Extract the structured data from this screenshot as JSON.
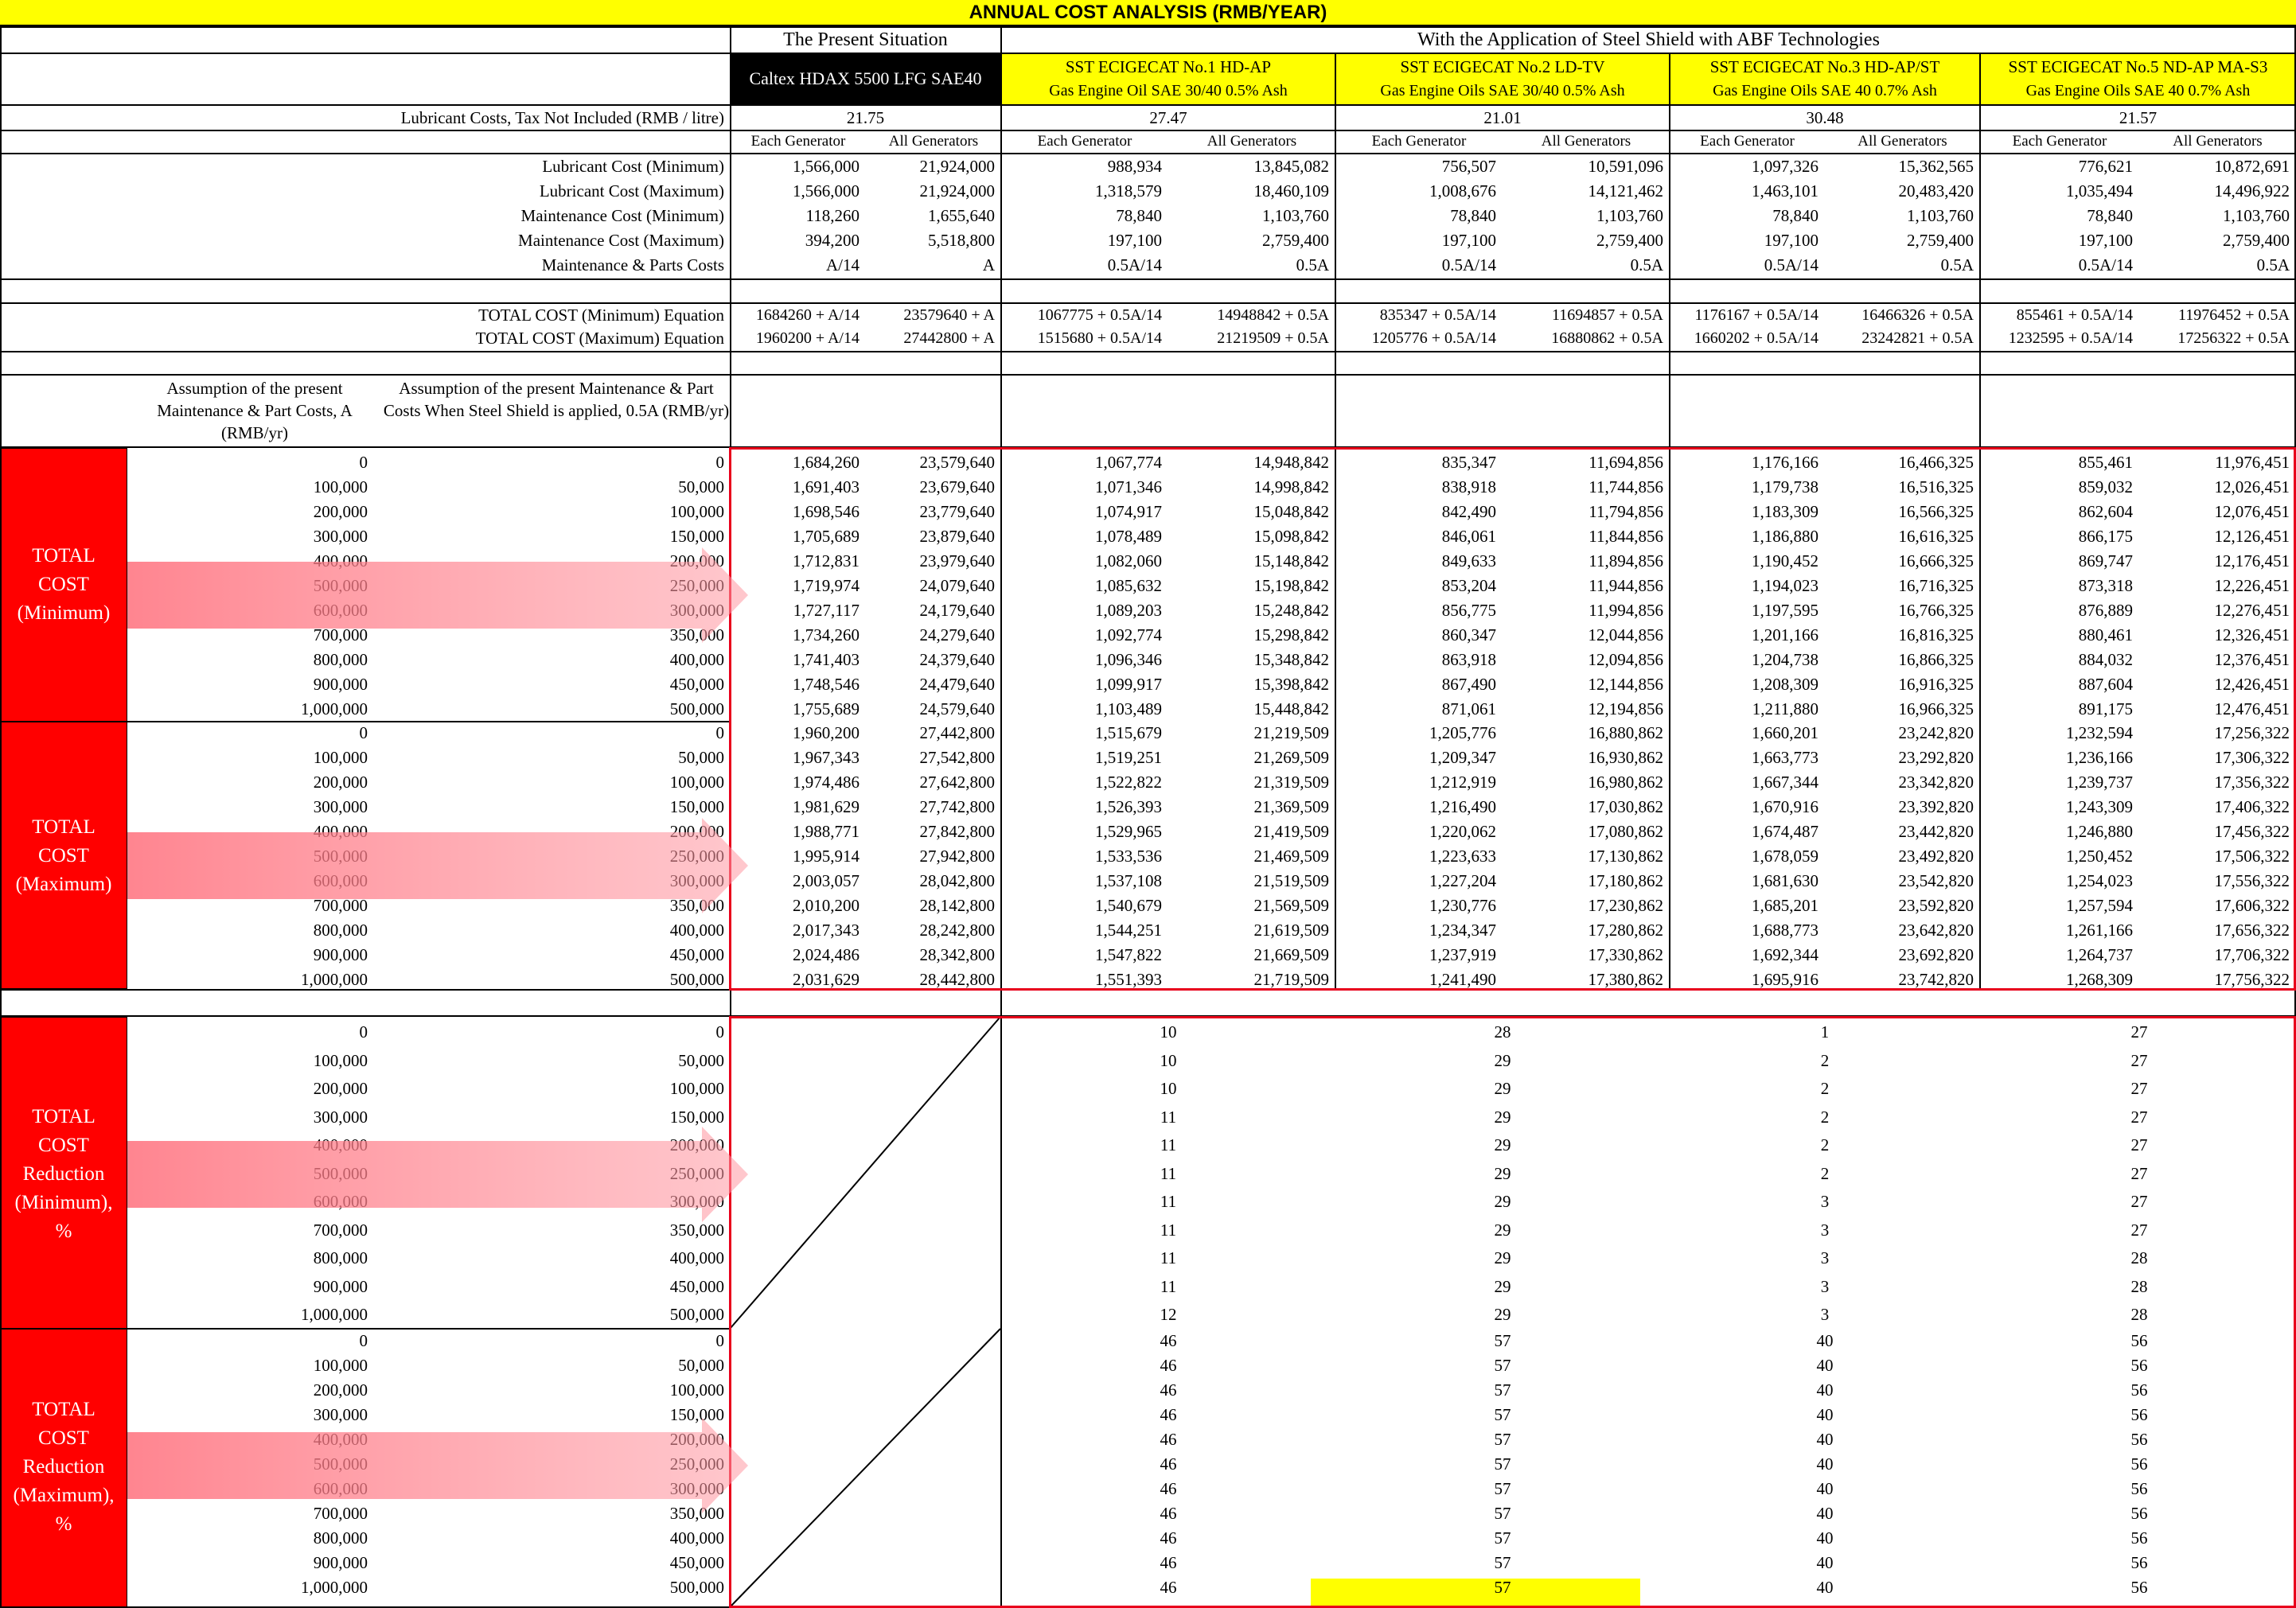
{
  "title": "ANNUAL COST ANALYSIS (RMB/YEAR)",
  "header": {
    "present_situation": "The Present Situation",
    "with_application": "With the Application of Steel Shield with ABF Technologies",
    "present_product": "Caltex HDAX 5500 LFG SAE40",
    "products": [
      {
        "name": "SST ECIGECAT No.1 HD-AP",
        "sub": "Gas Engine Oil SAE 30/40 0.5% Ash"
      },
      {
        "name": "SST ECIGECAT No.2 LD-TV",
        "sub": "Gas Engine Oils SAE 30/40 0.5% Ash"
      },
      {
        "name": "SST ECIGECAT No.3 HD-AP/ST",
        "sub": "Gas Engine Oils SAE 40 0.7% Ash"
      },
      {
        "name": "SST ECIGECAT No.5 ND-AP MA-S3",
        "sub": "Gas Engine Oils SAE 40 0.7% Ash"
      }
    ]
  },
  "lubricant_price": {
    "label": "Lubricant Costs, Tax Not Included (RMB / litre)",
    "values": [
      "21.75",
      "27.47",
      "21.01",
      "30.48",
      "21.57"
    ]
  },
  "subheads": [
    "Each Generator",
    "All Generators",
    "Each Generator",
    "All Generators",
    "Each Generator",
    "All Generators",
    "Each Generator",
    "All Generators",
    "Each Generator",
    "All Generators"
  ],
  "cost_rows": [
    {
      "label": "Lubricant Cost (Minimum)",
      "values": [
        "1,566,000",
        "21,924,000",
        "988,934",
        "13,845,082",
        "756,507",
        "10,591,096",
        "1,097,326",
        "15,362,565",
        "776,621",
        "10,872,691"
      ]
    },
    {
      "label": "Lubricant Cost (Maximum)",
      "values": [
        "1,566,000",
        "21,924,000",
        "1,318,579",
        "18,460,109",
        "1,008,676",
        "14,121,462",
        "1,463,101",
        "20,483,420",
        "1,035,494",
        "14,496,922"
      ]
    },
    {
      "label": "Maintenance Cost (Minimum)",
      "values": [
        "118,260",
        "1,655,640",
        "78,840",
        "1,103,760",
        "78,840",
        "1,103,760",
        "78,840",
        "1,103,760",
        "78,840",
        "1,103,760"
      ]
    },
    {
      "label": "Maintenance Cost (Maximum)",
      "values": [
        "394,200",
        "5,518,800",
        "197,100",
        "2,759,400",
        "197,100",
        "2,759,400",
        "197,100",
        "2,759,400",
        "197,100",
        "2,759,400"
      ]
    },
    {
      "label": "Maintenance & Parts Costs",
      "values": [
        "A/14",
        "A",
        "0.5A/14",
        "0.5A",
        "0.5A/14",
        "0.5A",
        "0.5A/14",
        "0.5A",
        "0.5A/14",
        "0.5A"
      ]
    }
  ],
  "equation_rows": [
    {
      "label": "TOTAL COST (Minimum) Equation",
      "values": [
        "1684260 + A/14",
        "23579640 + A",
        "1067775 + 0.5A/14",
        "14948842 + 0.5A",
        "835347 + 0.5A/14",
        "11694857 + 0.5A",
        "1176167 + 0.5A/14",
        "16466326 + 0.5A",
        "855461 + 0.5A/14",
        "11976452 + 0.5A"
      ]
    },
    {
      "label": "TOTAL COST (Maximum) Equation",
      "values": [
        "1960200 + A/14",
        "27442800 + A",
        "1515680 + 0.5A/14",
        "21219509 + 0.5A",
        "1205776 + 0.5A/14",
        "16880862 + 0.5A",
        "1660202 + 0.5A/14",
        "23242821 + 0.5A",
        "1232595 + 0.5A/14",
        "17256322 + 0.5A"
      ]
    }
  ],
  "assumption_labels": {
    "a": "Assumption of the present Maintenance & Part Costs, A (RMB/yr)",
    "b": "Assumption of the present Maintenance & Part Costs When Steel Shield is applied, 0.5A (RMB/yr)"
  },
  "assumption_a": [
    "0",
    "100,000",
    "200,000",
    "300,000",
    "400,000",
    "500,000",
    "600,000",
    "700,000",
    "800,000",
    "900,000",
    "1,000,000"
  ],
  "assumption_b": [
    "0",
    "50,000",
    "100,000",
    "150,000",
    "200,000",
    "250,000",
    "300,000",
    "350,000",
    "400,000",
    "450,000",
    "500,000"
  ],
  "section_labels": {
    "min": [
      "TOTAL",
      "COST",
      "(Minimum)"
    ],
    "max": [
      "TOTAL",
      "COST",
      "(Maximum)"
    ],
    "red_min": [
      "TOTAL",
      "COST",
      "Reduction",
      "(Minimum),",
      "%"
    ],
    "red_max": [
      "TOTAL",
      "COST",
      "Reduction",
      "(Maximum),",
      "%"
    ]
  },
  "total_min": [
    [
      "1,684,260",
      "23,579,640",
      "1,067,774",
      "14,948,842",
      "835,347",
      "11,694,856",
      "1,176,166",
      "16,466,325",
      "855,461",
      "11,976,451"
    ],
    [
      "1,691,403",
      "23,679,640",
      "1,071,346",
      "14,998,842",
      "838,918",
      "11,744,856",
      "1,179,738",
      "16,516,325",
      "859,032",
      "12,026,451"
    ],
    [
      "1,698,546",
      "23,779,640",
      "1,074,917",
      "15,048,842",
      "842,490",
      "11,794,856",
      "1,183,309",
      "16,566,325",
      "862,604",
      "12,076,451"
    ],
    [
      "1,705,689",
      "23,879,640",
      "1,078,489",
      "15,098,842",
      "846,061",
      "11,844,856",
      "1,186,880",
      "16,616,325",
      "866,175",
      "12,126,451"
    ],
    [
      "1,712,831",
      "23,979,640",
      "1,082,060",
      "15,148,842",
      "849,633",
      "11,894,856",
      "1,190,452",
      "16,666,325",
      "869,747",
      "12,176,451"
    ],
    [
      "1,719,974",
      "24,079,640",
      "1,085,632",
      "15,198,842",
      "853,204",
      "11,944,856",
      "1,194,023",
      "16,716,325",
      "873,318",
      "12,226,451"
    ],
    [
      "1,727,117",
      "24,179,640",
      "1,089,203",
      "15,248,842",
      "856,775",
      "11,994,856",
      "1,197,595",
      "16,766,325",
      "876,889",
      "12,276,451"
    ],
    [
      "1,734,260",
      "24,279,640",
      "1,092,774",
      "15,298,842",
      "860,347",
      "12,044,856",
      "1,201,166",
      "16,816,325",
      "880,461",
      "12,326,451"
    ],
    [
      "1,741,403",
      "24,379,640",
      "1,096,346",
      "15,348,842",
      "863,918",
      "12,094,856",
      "1,204,738",
      "16,866,325",
      "884,032",
      "12,376,451"
    ],
    [
      "1,748,546",
      "24,479,640",
      "1,099,917",
      "15,398,842",
      "867,490",
      "12,144,856",
      "1,208,309",
      "16,916,325",
      "887,604",
      "12,426,451"
    ],
    [
      "1,755,689",
      "24,579,640",
      "1,103,489",
      "15,448,842",
      "871,061",
      "12,194,856",
      "1,211,880",
      "16,966,325",
      "891,175",
      "12,476,451"
    ]
  ],
  "total_max": [
    [
      "1,960,200",
      "27,442,800",
      "1,515,679",
      "21,219,509",
      "1,205,776",
      "16,880,862",
      "1,660,201",
      "23,242,820",
      "1,232,594",
      "17,256,322"
    ],
    [
      "1,967,343",
      "27,542,800",
      "1,519,251",
      "21,269,509",
      "1,209,347",
      "16,930,862",
      "1,663,773",
      "23,292,820",
      "1,236,166",
      "17,306,322"
    ],
    [
      "1,974,486",
      "27,642,800",
      "1,522,822",
      "21,319,509",
      "1,212,919",
      "16,980,862",
      "1,667,344",
      "23,342,820",
      "1,239,737",
      "17,356,322"
    ],
    [
      "1,981,629",
      "27,742,800",
      "1,526,393",
      "21,369,509",
      "1,216,490",
      "17,030,862",
      "1,670,916",
      "23,392,820",
      "1,243,309",
      "17,406,322"
    ],
    [
      "1,988,771",
      "27,842,800",
      "1,529,965",
      "21,419,509",
      "1,220,062",
      "17,080,862",
      "1,674,487",
      "23,442,820",
      "1,246,880",
      "17,456,322"
    ],
    [
      "1,995,914",
      "27,942,800",
      "1,533,536",
      "21,469,509",
      "1,223,633",
      "17,130,862",
      "1,678,059",
      "23,492,820",
      "1,250,452",
      "17,506,322"
    ],
    [
      "2,003,057",
      "28,042,800",
      "1,537,108",
      "21,519,509",
      "1,227,204",
      "17,180,862",
      "1,681,630",
      "23,542,820",
      "1,254,023",
      "17,556,322"
    ],
    [
      "2,010,200",
      "28,142,800",
      "1,540,679",
      "21,569,509",
      "1,230,776",
      "17,230,862",
      "1,685,201",
      "23,592,820",
      "1,257,594",
      "17,606,322"
    ],
    [
      "2,017,343",
      "28,242,800",
      "1,544,251",
      "21,619,509",
      "1,234,347",
      "17,280,862",
      "1,688,773",
      "23,642,820",
      "1,261,166",
      "17,656,322"
    ],
    [
      "2,024,486",
      "28,342,800",
      "1,547,822",
      "21,669,509",
      "1,237,919",
      "17,330,862",
      "1,692,344",
      "23,692,820",
      "1,264,737",
      "17,706,322"
    ],
    [
      "2,031,629",
      "28,442,800",
      "1,551,393",
      "21,719,509",
      "1,241,490",
      "17,380,862",
      "1,695,916",
      "23,742,820",
      "1,268,309",
      "17,756,322"
    ]
  ],
  "reduction_min": [
    [
      "10",
      "28",
      "1",
      "27"
    ],
    [
      "10",
      "29",
      "2",
      "27"
    ],
    [
      "10",
      "29",
      "2",
      "27"
    ],
    [
      "11",
      "29",
      "2",
      "27"
    ],
    [
      "11",
      "29",
      "2",
      "27"
    ],
    [
      "11",
      "29",
      "2",
      "27"
    ],
    [
      "11",
      "29",
      "3",
      "27"
    ],
    [
      "11",
      "29",
      "3",
      "27"
    ],
    [
      "11",
      "29",
      "3",
      "28"
    ],
    [
      "11",
      "29",
      "3",
      "28"
    ],
    [
      "12",
      "29",
      "3",
      "28"
    ]
  ],
  "reduction_max": [
    [
      "46",
      "57",
      "40",
      "56"
    ],
    [
      "46",
      "57",
      "40",
      "56"
    ],
    [
      "46",
      "57",
      "40",
      "56"
    ],
    [
      "46",
      "57",
      "40",
      "56"
    ],
    [
      "46",
      "57",
      "40",
      "56"
    ],
    [
      "46",
      "57",
      "40",
      "56"
    ],
    [
      "46",
      "57",
      "40",
      "56"
    ],
    [
      "46",
      "57",
      "40",
      "56"
    ],
    [
      "46",
      "57",
      "40",
      "56"
    ],
    [
      "46",
      "57",
      "40",
      "56"
    ],
    [
      "46",
      "57",
      "40",
      "56"
    ]
  ],
  "colors": {
    "title_bg": "#ffff00",
    "product_bg": "#ffff00",
    "present_product_bg": "#000000",
    "section_red": "#ff0000",
    "box_red": "#e8001c",
    "arrow_pink": "#ff8a94",
    "highlight": "#ffff00"
  }
}
